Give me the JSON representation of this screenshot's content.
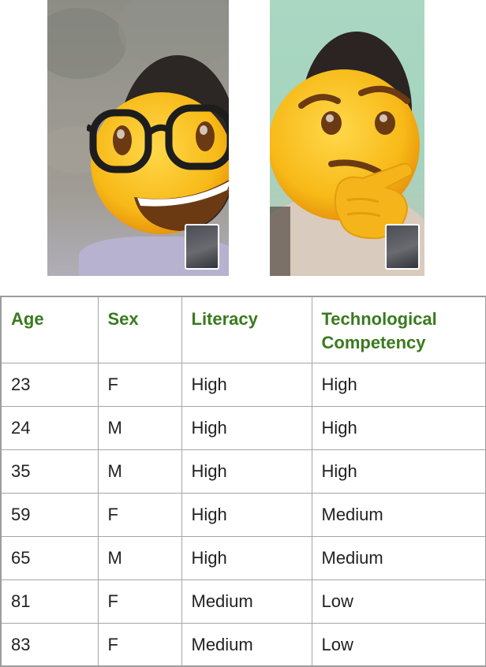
{
  "photos": [
    {
      "subject": "participant-with-nerd-emoji",
      "overlay_icon": "nerd-face-emoji"
    },
    {
      "subject": "participant-with-thinking-emoji",
      "overlay_icon": "thinking-face-emoji"
    }
  ],
  "table": {
    "headers": [
      "Age",
      "Sex",
      "Literacy",
      "Technological Competency"
    ],
    "rows": [
      [
        "23",
        "F",
        "High",
        "High"
      ],
      [
        "24",
        "M",
        "High",
        "High"
      ],
      [
        "35",
        "M",
        "High",
        "High"
      ],
      [
        "59",
        "F",
        "High",
        "Medium"
      ],
      [
        "65",
        "M",
        "High",
        "Medium"
      ],
      [
        "81",
        "F",
        "Medium",
        "Low"
      ],
      [
        "83",
        "F",
        "Medium",
        "Low"
      ]
    ]
  },
  "colors": {
    "header_text": "#3a7a1f",
    "cell_text": "#222222",
    "border": "#a5a5a5",
    "emoji_face": "#f7b917"
  }
}
